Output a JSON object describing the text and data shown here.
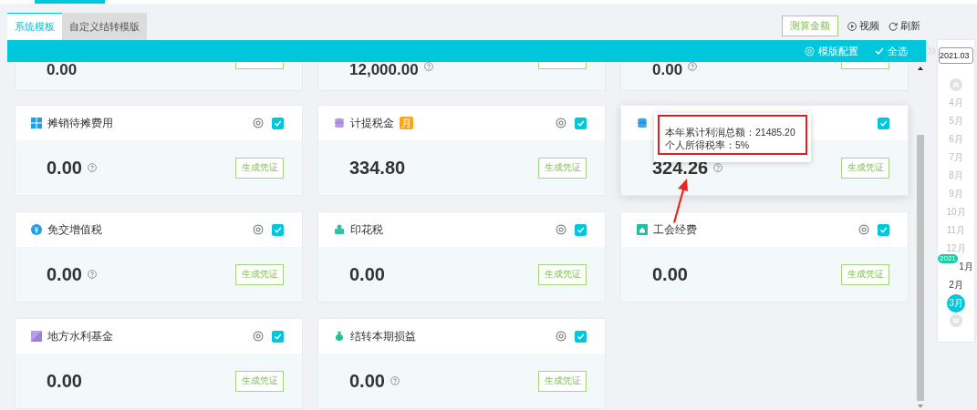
{
  "tabs": [
    {
      "label": "系统模板",
      "selected": true
    },
    {
      "label": "自定义结转模版",
      "selected": false
    }
  ],
  "actions": {
    "calculate": "测算金额",
    "video": "视频",
    "refresh": "刷新"
  },
  "toolbar": {
    "template_settings": "模版配置",
    "select_all": "全选"
  },
  "date_field": {
    "value": "2021.03"
  },
  "months": [
    {
      "label": "4月",
      "disabled": true,
      "selected": false
    },
    {
      "label": "5月",
      "disabled": true,
      "selected": false
    },
    {
      "label": "6月",
      "disabled": true,
      "selected": false
    },
    {
      "label": "7月",
      "disabled": true,
      "selected": false
    },
    {
      "label": "8月",
      "disabled": true,
      "selected": false
    },
    {
      "label": "9月",
      "disabled": true,
      "selected": false
    },
    {
      "label": "10月",
      "disabled": true,
      "selected": false
    },
    {
      "label": "11月",
      "disabled": true,
      "selected": false
    },
    {
      "label": "12月",
      "disabled": true,
      "selected": false
    },
    {
      "label": "1月",
      "disabled": false,
      "selected": false,
      "year_tag": "2021"
    },
    {
      "label": "2月",
      "disabled": false,
      "selected": false
    },
    {
      "label": "3月",
      "disabled": false,
      "selected": true
    }
  ],
  "partial_cards": [
    {
      "value": "0.00",
      "help": false
    },
    {
      "value": "12,000.00",
      "help": true
    },
    {
      "value": "0.00",
      "help": true
    }
  ],
  "cards": [
    {
      "title": "摊销待摊费用",
      "settings": true,
      "checked": true,
      "value": "0.00",
      "help": true,
      "button": "生成凭证",
      "hovered": false
    },
    {
      "title": "计提税金",
      "badge": "月",
      "settings": true,
      "checked": true,
      "value": "334.80",
      "help": false,
      "button": "生成凭证",
      "hovered": false
    },
    {
      "settings": false,
      "checked": true,
      "value": "324.26",
      "help": true,
      "button": "生成凭证",
      "hovered": true,
      "tooltip": [
        "本年累计利润总额：21485.20",
        "个人所得税率：5%"
      ]
    },
    {
      "title": "免交增值税",
      "settings": true,
      "checked": true,
      "value": "0.00",
      "help": true,
      "button": "生成凭证",
      "hovered": false
    },
    {
      "title": "印花税",
      "settings": true,
      "checked": true,
      "value": "0.00",
      "help": false,
      "button": "生成凭证",
      "hovered": false
    },
    {
      "title": "工会经费",
      "settings": true,
      "checked": true,
      "value": "0.00",
      "help": false,
      "button": "生成凭证",
      "hovered": false
    },
    {
      "title": "地方水利基金",
      "settings": true,
      "checked": true,
      "value": "0.00",
      "help": false,
      "button": "生成凭证",
      "hovered": false
    },
    {
      "title": "结转本期损益",
      "settings": true,
      "checked": true,
      "value": "0.00",
      "help": true,
      "button": "生成凭证",
      "hovered": false
    }
  ]
}
